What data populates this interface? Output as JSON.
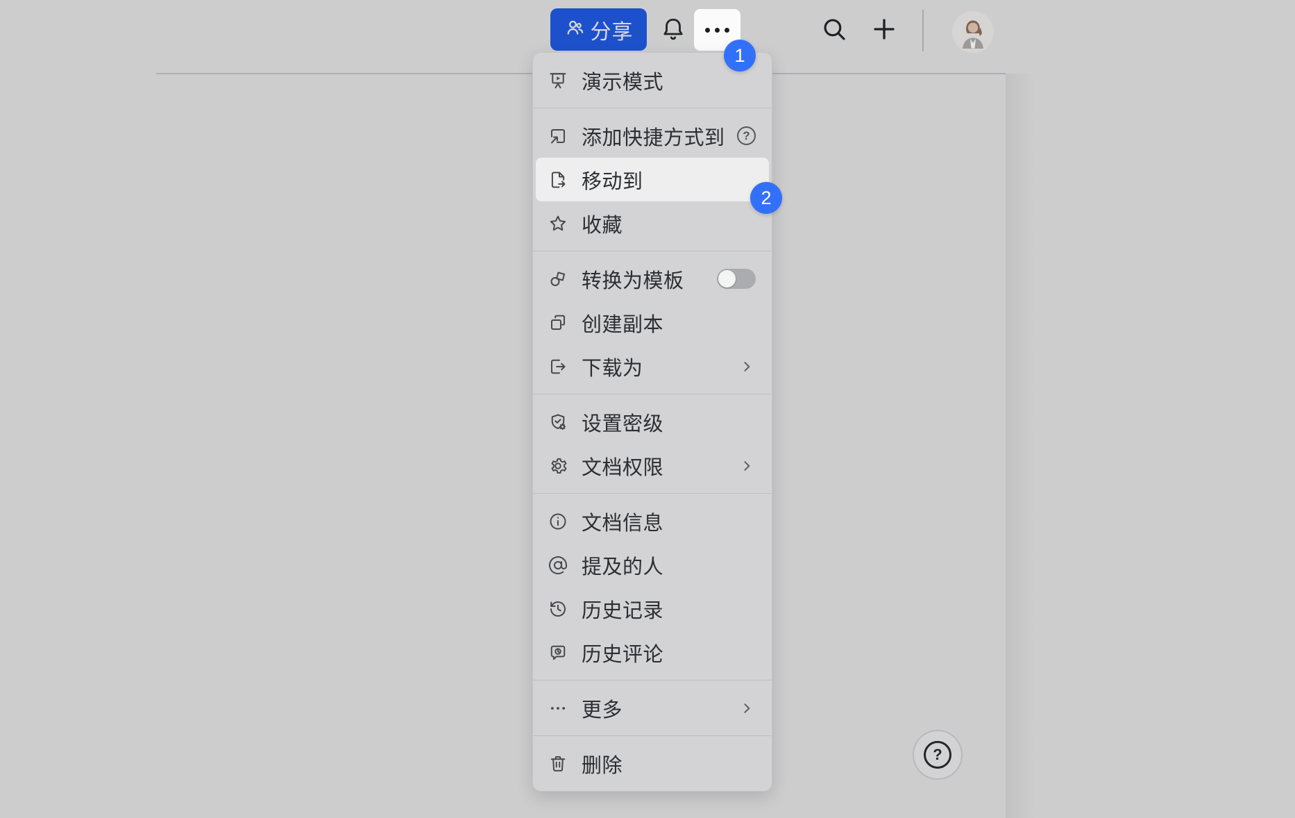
{
  "toolbar": {
    "share": {
      "label": "分享"
    }
  },
  "menu": {
    "help_glyph": "?",
    "sections": [
      {
        "items": [
          {
            "id": "presentation-mode",
            "label": "演示模式",
            "icon": "presentation-icon"
          }
        ]
      },
      {
        "items": [
          {
            "id": "add-shortcut-to",
            "label": "添加快捷方式到",
            "icon": "shortcut-icon",
            "trailing": "help"
          },
          {
            "id": "move-to",
            "label": "移动到",
            "icon": "move-icon",
            "highlighted": true
          },
          {
            "id": "favorite",
            "label": "收藏",
            "icon": "star-icon"
          }
        ]
      },
      {
        "items": [
          {
            "id": "convert-to-template",
            "label": "转换为模板",
            "icon": "template-icon",
            "trailing": "toggle",
            "toggle_on": false
          },
          {
            "id": "duplicate",
            "label": "创建副本",
            "icon": "copy-icon"
          },
          {
            "id": "download-as",
            "label": "下载为",
            "icon": "download-icon",
            "trailing": "chevron"
          }
        ]
      },
      {
        "items": [
          {
            "id": "set-security-level",
            "label": "设置密级",
            "icon": "security-icon"
          },
          {
            "id": "doc-permission",
            "label": "文档权限",
            "icon": "gear-icon",
            "trailing": "chevron"
          }
        ]
      },
      {
        "items": [
          {
            "id": "doc-info",
            "label": "文档信息",
            "icon": "info-icon"
          },
          {
            "id": "mentioned-people",
            "label": "提及的人",
            "icon": "mention-icon"
          },
          {
            "id": "history",
            "label": "历史记录",
            "icon": "history-icon"
          },
          {
            "id": "comment-history",
            "label": "历史评论",
            "icon": "comment-history-icon"
          }
        ]
      },
      {
        "items": [
          {
            "id": "more",
            "label": "更多",
            "icon": "more-icon",
            "trailing": "chevron"
          }
        ]
      },
      {
        "items": [
          {
            "id": "delete",
            "label": "删除",
            "icon": "trash-icon"
          }
        ]
      }
    ]
  },
  "annotations": {
    "step1": "1",
    "step2": "2"
  },
  "help_button": {
    "glyph": "?"
  },
  "colors": {
    "page_background": "#cdcdce",
    "menu_background": "#d3d3d5",
    "highlight_row": "#eeeeef",
    "share_blue": "#1d51cc",
    "badge_blue": "#3370fa"
  }
}
